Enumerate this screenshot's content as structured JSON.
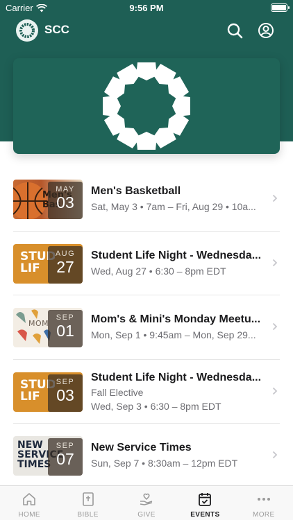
{
  "status_bar": {
    "carrier": "Carrier",
    "time": "9:56 PM"
  },
  "header": {
    "app_name": "SCC"
  },
  "colors": {
    "brand": "#1e5f55",
    "accent": "#1c1c1e"
  },
  "events": [
    {
      "month": "MAY",
      "day": "03",
      "thumb_text": "Men's Bas",
      "title": "Men's Basketball",
      "line1": "Sat, May 3 • 7am – Fri, Aug 29 • 10a...",
      "line2": ""
    },
    {
      "month": "AUG",
      "day": "27",
      "thumb_text": "STUDEN LIF",
      "title": "Student Life Night - Wednesda...",
      "line1": "Wed, Aug 27 • 6:30 – 8pm EDT",
      "line2": ""
    },
    {
      "month": "SEP",
      "day": "01",
      "thumb_text": "MOM",
      "title": "Mom's & Mini's Monday Meetu...",
      "line1": "Mon, Sep 1 • 9:45am – Mon, Sep 29...",
      "line2": ""
    },
    {
      "month": "SEP",
      "day": "03",
      "thumb_text": "STUDEN LIF",
      "title": "Student Life Night - Wednesda...",
      "line1": "Fall Elective",
      "line2": "Wed, Sep 3 • 6:30 – 8pm EDT"
    },
    {
      "month": "SEP",
      "day": "07",
      "thumb_text": "NEW SERVICE TIMES",
      "title": "New Service Times",
      "line1": "Sun, Sep 7 • 8:30am – 12pm EDT",
      "line2": ""
    }
  ],
  "tabs": [
    {
      "label": "HOME",
      "icon": "home-icon"
    },
    {
      "label": "BIBLE",
      "icon": "bible-icon"
    },
    {
      "label": "GIVE",
      "icon": "give-icon"
    },
    {
      "label": "EVENTS",
      "icon": "events-icon",
      "active": true
    },
    {
      "label": "MORE",
      "icon": "more-icon"
    }
  ]
}
